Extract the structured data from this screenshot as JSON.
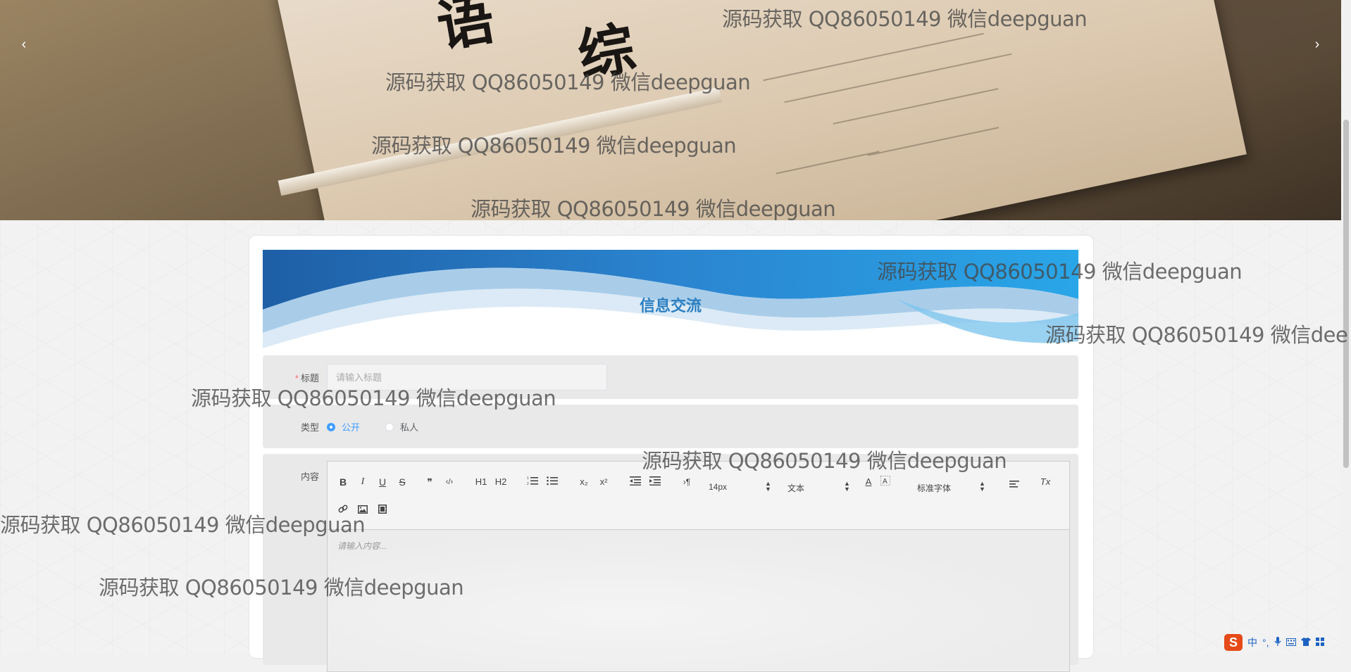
{
  "banner": {
    "prev_label": "‹",
    "next_label": "›",
    "book_glyphs": [
      "语",
      "综"
    ]
  },
  "form": {
    "header_title": "信息交流",
    "title_label": "标题",
    "title_required_mark": "*",
    "title_placeholder": "请输入标题",
    "type_label": "类型",
    "type_options": [
      {
        "label": "公开",
        "checked": true
      },
      {
        "label": "私人",
        "checked": false
      }
    ],
    "content_label": "内容",
    "editor_placeholder": "请输入内容...",
    "toolbar": {
      "font_size": "14px",
      "heading": "文本",
      "font_family": "标准字体",
      "buttons": [
        "B",
        "I",
        "U",
        "S",
        "❞",
        "‹/›",
        "H1",
        "H2",
        "ordered-list",
        "bullet-list",
        "x₂",
        "x²",
        "outdent",
        "indent",
        "›¶",
        "A",
        "highlight",
        "align",
        "Tx",
        "link",
        "image",
        "video"
      ]
    }
  },
  "watermark_text": "源码获取 QQ86050149 微信deepguan",
  "watermark_partial": "源码获取 QQ86050149 微信dee",
  "ime": {
    "logo": "S",
    "items": [
      "中",
      "°,",
      "mic",
      "keyboard",
      "shirt",
      "grid"
    ]
  },
  "colors": {
    "accent": "#409eff",
    "title": "#2c7fc1",
    "required": "#f56c6c"
  }
}
